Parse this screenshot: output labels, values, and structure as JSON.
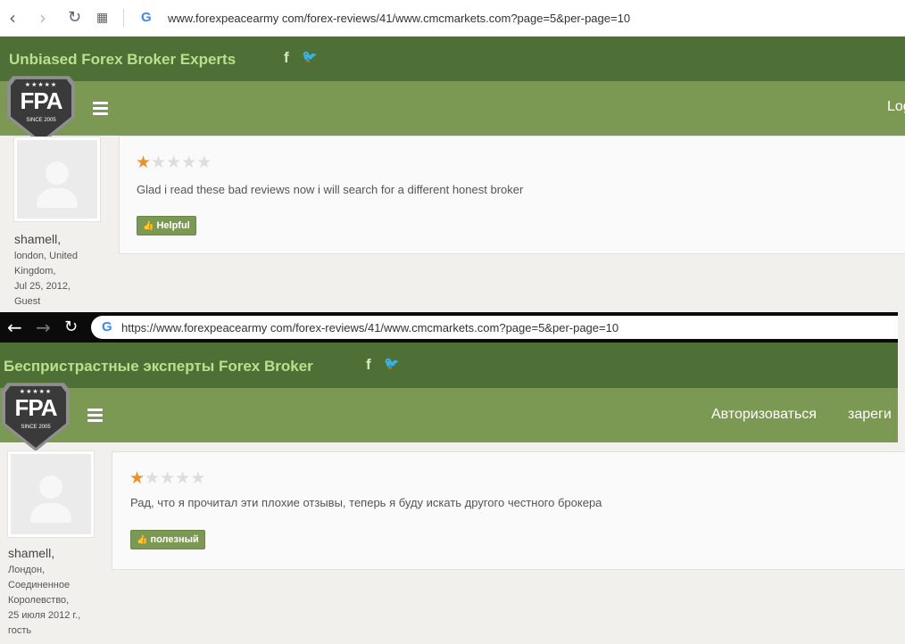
{
  "english": {
    "url": "www.forexpeacearmy com/forex-reviews/41/www.cmcmarkets.com?page=5&per-page=10",
    "site_title": "Unbiased Forex Broker Experts",
    "nav": {
      "login": "Log"
    },
    "review": {
      "text": "Glad i read these bad reviews now i will search for a different honest broker",
      "helpful": "Helpful",
      "user": {
        "name": "shamell,",
        "meta": [
          "london, United",
          "Kingdom,",
          "Jul 25, 2012,",
          "Guest"
        ]
      }
    }
  },
  "russian": {
    "url": "https://www.forexpeacearmy com/forex-reviews/41/www.cmcmarkets.com?page=5&per-page=10",
    "site_title": "Беспристрастные эксперты Forex Broker",
    "nav": {
      "login": "Авторизоваться",
      "register": "зареги"
    },
    "review": {
      "text": "Рад, что я прочитал эти плохие отзывы, теперь я буду искать другого честного брокера",
      "helpful": "полезный",
      "user": {
        "name": "shamell,",
        "meta": [
          "Лондон,",
          "Соединенное",
          "Королевство,",
          "25 июля 2012 г.,",
          "гость"
        ]
      }
    }
  },
  "logo": {
    "text": "FPA",
    "stars": "★★★★★",
    "since": "SINCE 2005"
  },
  "social": {
    "facebook": "f",
    "twitter": "🐦"
  },
  "rating": {
    "stars_filled": 1,
    "stars_total": 5
  },
  "colors": {
    "header_dark": "#4e6f36",
    "header_nav": "#7b9952",
    "title_text": "#b9e08c",
    "star_on": "#e8922d",
    "star_off": "#dddddd"
  },
  "icons": [
    "back-icon",
    "forward-icon",
    "reload-icon",
    "apps-icon",
    "google-icon",
    "facebook-icon",
    "twitter-icon",
    "menu-icon",
    "thumbs-up-icon",
    "star-icon",
    "avatar-icon"
  ]
}
